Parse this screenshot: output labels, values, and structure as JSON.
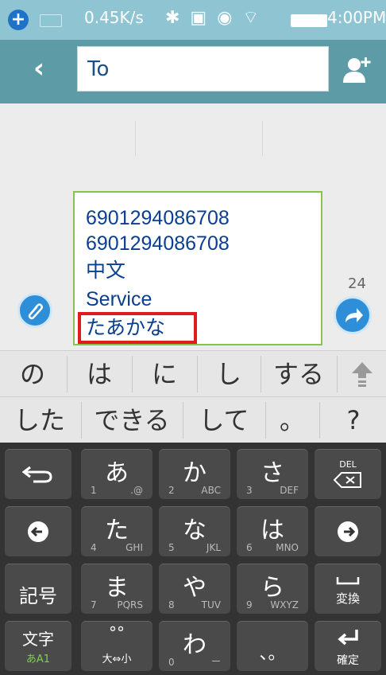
{
  "status_bar": {
    "speed": "0.45K/s",
    "icons": "✱ ▣ ◉ ⌔",
    "time": "4:00PM"
  },
  "header": {
    "back_glyph": "‹",
    "to_label": "To",
    "contact_icon": "add-contact-icon"
  },
  "compose": {
    "lines": [
      "6901294086708",
      "6901294086708",
      "中文",
      "Service",
      "たあかな"
    ],
    "counter": "24"
  },
  "candidates": {
    "row1": [
      "の",
      "は",
      "に",
      "し",
      "する"
    ],
    "row2": [
      "した",
      "できる",
      "して",
      "。",
      "?"
    ]
  },
  "keyboard": {
    "rows": [
      [
        {
          "main": "",
          "sub": ""
        },
        {
          "main": "あ",
          "sub": "1",
          "subr": ".@"
        },
        {
          "main": "か",
          "sub": "2",
          "subr": "ABC"
        },
        {
          "main": "さ",
          "sub": "3",
          "subr": "DEF"
        },
        {
          "main": "DEL",
          "sub": ""
        }
      ],
      [
        {
          "main": "",
          "sub": ""
        },
        {
          "main": "た",
          "sub": "4",
          "subr": "GHI"
        },
        {
          "main": "な",
          "sub": "5",
          "subr": "JKL"
        },
        {
          "main": "は",
          "sub": "6",
          "subr": "MNO"
        },
        {
          "main": "",
          "sub": ""
        }
      ],
      [
        {
          "main": "記号",
          "sub": ""
        },
        {
          "main": "ま",
          "sub": "7",
          "subr": "PQRS"
        },
        {
          "main": "や",
          "sub": "8",
          "subr": "TUV"
        },
        {
          "main": "ら",
          "sub": "9",
          "subr": "WXYZ"
        },
        {
          "main": "変換",
          "sub": ""
        }
      ],
      [
        {
          "main": "文字",
          "sub": "あA1"
        },
        {
          "main": "°°",
          "sub": "大⇔小"
        },
        {
          "main": "わ",
          "sub": "0",
          "subr": "ー"
        },
        {
          "main": "、。",
          "sub": ""
        },
        {
          "main": "確定",
          "sub": ""
        }
      ]
    ]
  }
}
